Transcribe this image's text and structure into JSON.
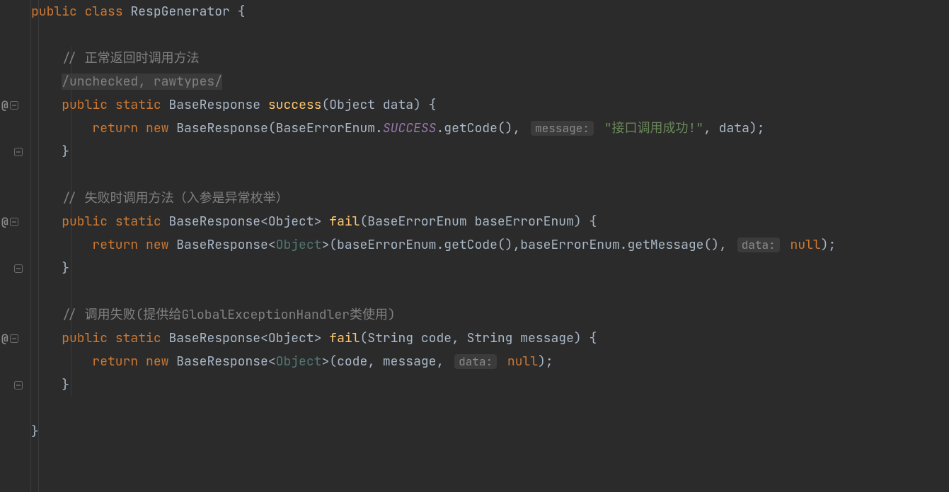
{
  "gutter": {
    "at": "@",
    "minus": "⊖",
    "plus": "⊕"
  },
  "code": {
    "l1": {
      "kw1": "public",
      "kw2": "class",
      "name": "RespGenerator",
      "brace": " {"
    },
    "l3": {
      "text": "// 正常返回时调用方法"
    },
    "l4": {
      "text": "/unchecked, rawtypes/"
    },
    "l5": {
      "kw1": "public",
      "kw2": "static",
      "type": "BaseResponse",
      "name": "success",
      "params": "(Object data) {"
    },
    "l6": {
      "kw1": "return",
      "kw2": "new",
      "type": "BaseResponse",
      "open": "(BaseErrorEnum.",
      "enum": "SUCCESS",
      "mid": ".getCode(), ",
      "hint": "message:",
      "str": "\"接口调用成功!\"",
      "rest": ", data);"
    },
    "l7": {
      "brace": "}"
    },
    "l9": {
      "text": "// 失败时调用方法（入参是异常枚举）"
    },
    "l10": {
      "kw1": "public",
      "kw2": "static",
      "type": "BaseResponse<Object>",
      "name": "fail",
      "params": "(BaseErrorEnum baseErrorEnum) {"
    },
    "l11": {
      "kw1": "return",
      "kw2": "new",
      "type": "BaseResponse<",
      "gen": "Object",
      "type2": ">",
      "mid": "(baseErrorEnum.getCode(),baseErrorEnum.getMessage(), ",
      "hint": "data:",
      "kw3": "null",
      "rest": ");"
    },
    "l12": {
      "brace": "}"
    },
    "l14": {
      "text": "// 调用失败(提供给GlobalExceptionHandler类使用)"
    },
    "l15": {
      "kw1": "public",
      "kw2": "static",
      "type": "BaseResponse<Object>",
      "name": "fail",
      "params": "(String code, String message) {"
    },
    "l16": {
      "kw1": "return",
      "kw2": "new",
      "type": "BaseResponse<",
      "gen": "Object",
      "type2": ">",
      "mid": "(code, message, ",
      "hint": "data:",
      "kw3": "null",
      "rest": ");"
    },
    "l17": {
      "brace": "}"
    },
    "l19": {
      "brace": "}"
    }
  }
}
